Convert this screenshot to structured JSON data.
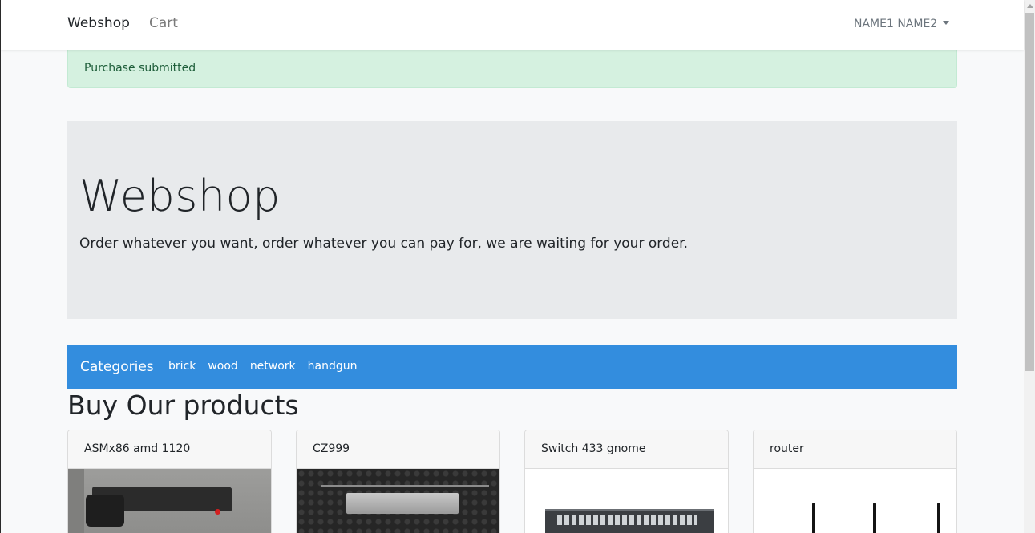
{
  "navbar": {
    "brand": "Webshop",
    "cart_label": "Cart",
    "user_name": "NAME1 NAME2"
  },
  "alert": {
    "message": "Purchase submitted"
  },
  "hero": {
    "title": "Webshop",
    "lead": "Order whatever you want, order whatever you can pay for, we are waiting for your order."
  },
  "categories": {
    "title": "Categories",
    "items": [
      {
        "label": "brick"
      },
      {
        "label": "wood"
      },
      {
        "label": "network"
      },
      {
        "label": "handgun"
      }
    ]
  },
  "products_section": {
    "title": "Buy Our products"
  },
  "products": [
    {
      "name": "ASMx86 amd 1120",
      "image": "handgun-photo"
    },
    {
      "name": "CZ999",
      "image": "handgun-case-photo"
    },
    {
      "name": "Switch 433 gnome",
      "image": "network-switch-photo"
    },
    {
      "name": "router",
      "image": "router-photo"
    }
  ],
  "colors": {
    "navbar_bg": "#ffffff",
    "alert_bg": "#d5f1e0",
    "hero_bg": "#e8eaec",
    "category_bar_bg": "#338dde",
    "page_bg": "#f8f9fa"
  }
}
